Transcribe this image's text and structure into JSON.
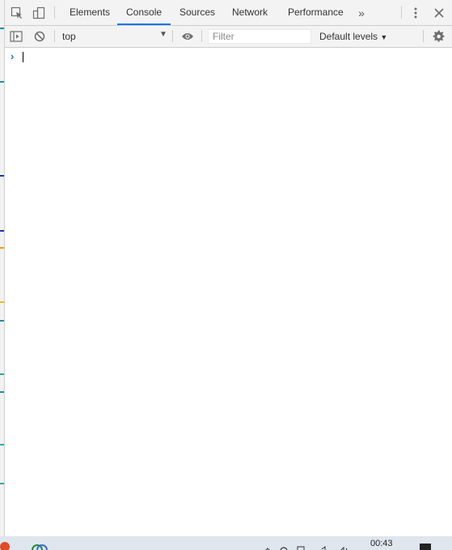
{
  "tabs": [
    {
      "label": "Elements"
    },
    {
      "label": "Console",
      "active": true
    },
    {
      "label": "Sources"
    },
    {
      "label": "Network"
    },
    {
      "label": "Performance"
    }
  ],
  "toolbar": {
    "context": "top",
    "filter_placeholder": "Filter",
    "levels": "Default levels"
  },
  "taskbar": {
    "time": "00:43"
  },
  "colors": {
    "accent": "#1a73e8"
  }
}
